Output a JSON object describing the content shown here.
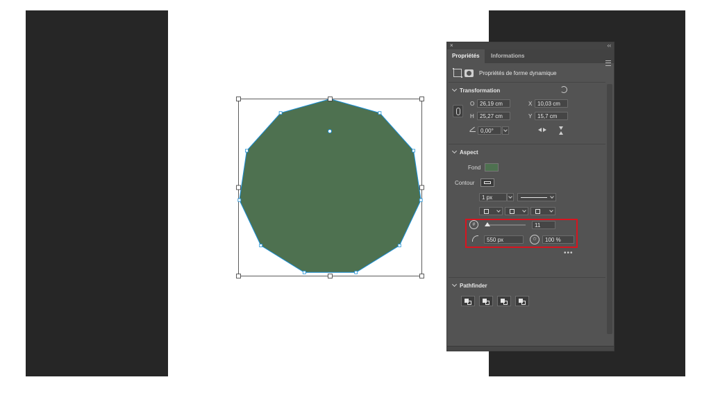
{
  "colors": {
    "shape_fill": "#4e7150",
    "selection": "#1a8fd6",
    "highlight": "#d8141f",
    "panel_bg": "#535353"
  },
  "panel": {
    "close_glyph": "×",
    "collapse_glyph": "‹‹",
    "tabs": [
      {
        "label": "Propriétés",
        "active": true
      },
      {
        "label": "Informations",
        "active": false
      }
    ],
    "header_title": "Propriétés de forme dynamique",
    "transform": {
      "title": "Transformation",
      "w_label": "O",
      "w_value": "26,19 cm",
      "x_label": "X",
      "x_value": "10,03 cm",
      "h_label": "H",
      "h_value": "25,27 cm",
      "y_label": "Y",
      "y_value": "15,7 cm",
      "angle_value": "0,00°"
    },
    "aspect": {
      "title": "Aspect",
      "fill_label": "Fond",
      "stroke_label": "Contour",
      "stroke_width": "1 px",
      "sides_value": "11",
      "corner_radius": "550 px",
      "star_ratio": "100 %",
      "more": "•••"
    },
    "pathfinder": {
      "title": "Pathfinder"
    }
  }
}
